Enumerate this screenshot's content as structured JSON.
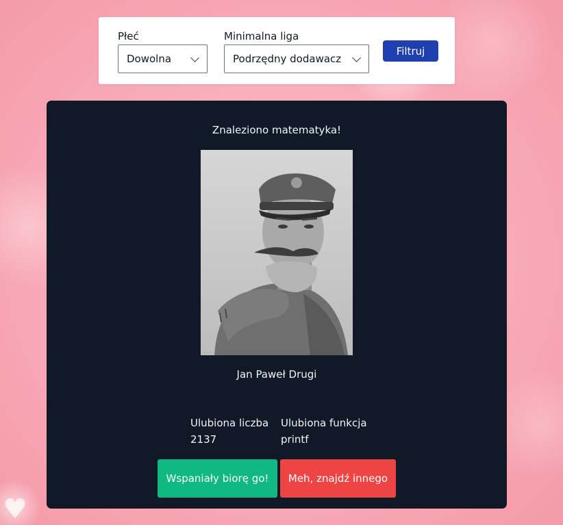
{
  "filters": {
    "gender_label": "Płeć",
    "gender_value": "Dowolna",
    "league_label": "Minimalna liga",
    "league_value": "Podrzędny dodawacz",
    "filter_button": "Filtruj"
  },
  "result": {
    "found_text": "Znaleziono matematyka!",
    "name": "Jan Paweł Drugi",
    "favorite_number_label": "Ulubiona liczba",
    "favorite_number_value": "2137",
    "favorite_function_label": "Ulubiona funkcja",
    "favorite_function_value": "printf"
  },
  "actions": {
    "accept_button": "Wspaniały biorę go!",
    "reject_button": "Meh, znajdź innego"
  },
  "colors": {
    "filter_button_bg": "#1e40af",
    "card_bg": "#111827",
    "accept_bg": "#10b981",
    "reject_bg": "#ef4444"
  },
  "icons": [
    "chevron-down-icon",
    "heart-icon"
  ]
}
